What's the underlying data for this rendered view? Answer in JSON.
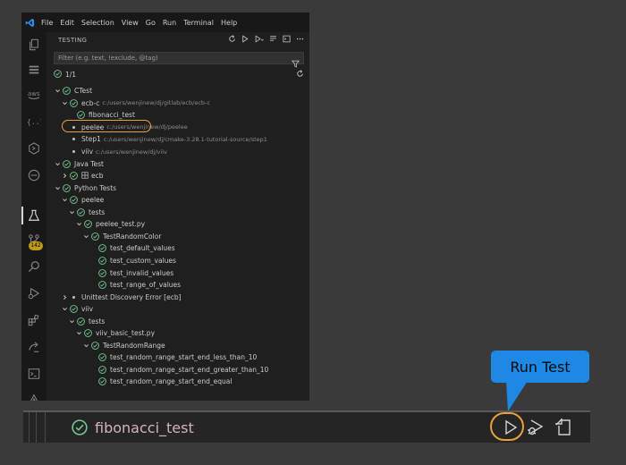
{
  "menubar": {
    "items": [
      "File",
      "Edit",
      "Selection",
      "View",
      "Go",
      "Run",
      "Terminal",
      "Help"
    ]
  },
  "activity_bar": {
    "icons": [
      "explorer-icon",
      "stack-icon",
      "aws-icon",
      "brackets-icon",
      "hexagon-icon",
      "remote-icon",
      "testing-icon",
      "gitlens-icon",
      "search-icon",
      "run-debug-icon",
      "extensions-icon",
      "git-icon",
      "terminal-icon",
      "chart-icon"
    ],
    "badge": "142"
  },
  "panel": {
    "title": "TESTING",
    "filter_placeholder": "Filter (e.g. text, !exclude, @tag)",
    "summary": "1/1"
  },
  "tree": [
    {
      "label": "CTest",
      "chev": "v",
      "status": "pass"
    },
    {
      "label": "ecb-c",
      "path": "c:/users/wenjinew/dj/gitlab/ecb/ecb-c",
      "chev": "v",
      "status": "pass"
    },
    {
      "label": "fibonacci_test",
      "status": "pass"
    },
    {
      "label": "peelee",
      "path": "c:/users/wenjinew/dj/peelee",
      "status": "dot"
    },
    {
      "label": "Step1",
      "path": "c:/users/wenjinew/dj/cmake-3.28.1-tutorial-source/step1",
      "status": "dot"
    },
    {
      "label": "viiv",
      "path": "c:/users/wenjinew/dj/viiv",
      "status": "dot"
    },
    {
      "label": "Java Test",
      "chev": "v",
      "status": "pass"
    },
    {
      "label": "ecb",
      "chev": ">",
      "status": "pass",
      "pkg": true
    },
    {
      "label": "Python Tests",
      "chev": "v",
      "status": "pass"
    },
    {
      "label": "peelee",
      "chev": "v",
      "status": "pass"
    },
    {
      "label": "tests",
      "chev": "v",
      "status": "pass"
    },
    {
      "label": "peelee_test.py",
      "chev": "v",
      "status": "pass"
    },
    {
      "label": "TestRandomColor",
      "chev": "v",
      "status": "pass"
    },
    {
      "label": "test_default_values",
      "status": "pass"
    },
    {
      "label": "test_custom_values",
      "status": "pass"
    },
    {
      "label": "test_invalid_values",
      "status": "pass"
    },
    {
      "label": "test_range_of_values",
      "status": "pass"
    },
    {
      "label": "Unittest Discovery Error [ecb]",
      "chev": ">",
      "status": "dot"
    },
    {
      "label": "viiv",
      "chev": "v",
      "status": "pass"
    },
    {
      "label": "tests",
      "chev": "v",
      "status": "pass"
    },
    {
      "label": "viiv_basic_test.py",
      "chev": "v",
      "status": "pass"
    },
    {
      "label": "TestRandomRange",
      "chev": "v",
      "status": "pass"
    },
    {
      "label": "test_random_range_start_end_less_than_10",
      "status": "pass"
    },
    {
      "label": "test_random_range_start_end_greater_than_10",
      "status": "pass"
    },
    {
      "label": "test_random_range_start_end_equal",
      "status": "pass"
    }
  ],
  "zoom_bar": {
    "label": "fibonacci_test"
  },
  "callout": {
    "text": "Run Test"
  },
  "colors": {
    "pass": "#73c991",
    "highlight": "#e8a13a",
    "callout": "#1e88e5"
  }
}
